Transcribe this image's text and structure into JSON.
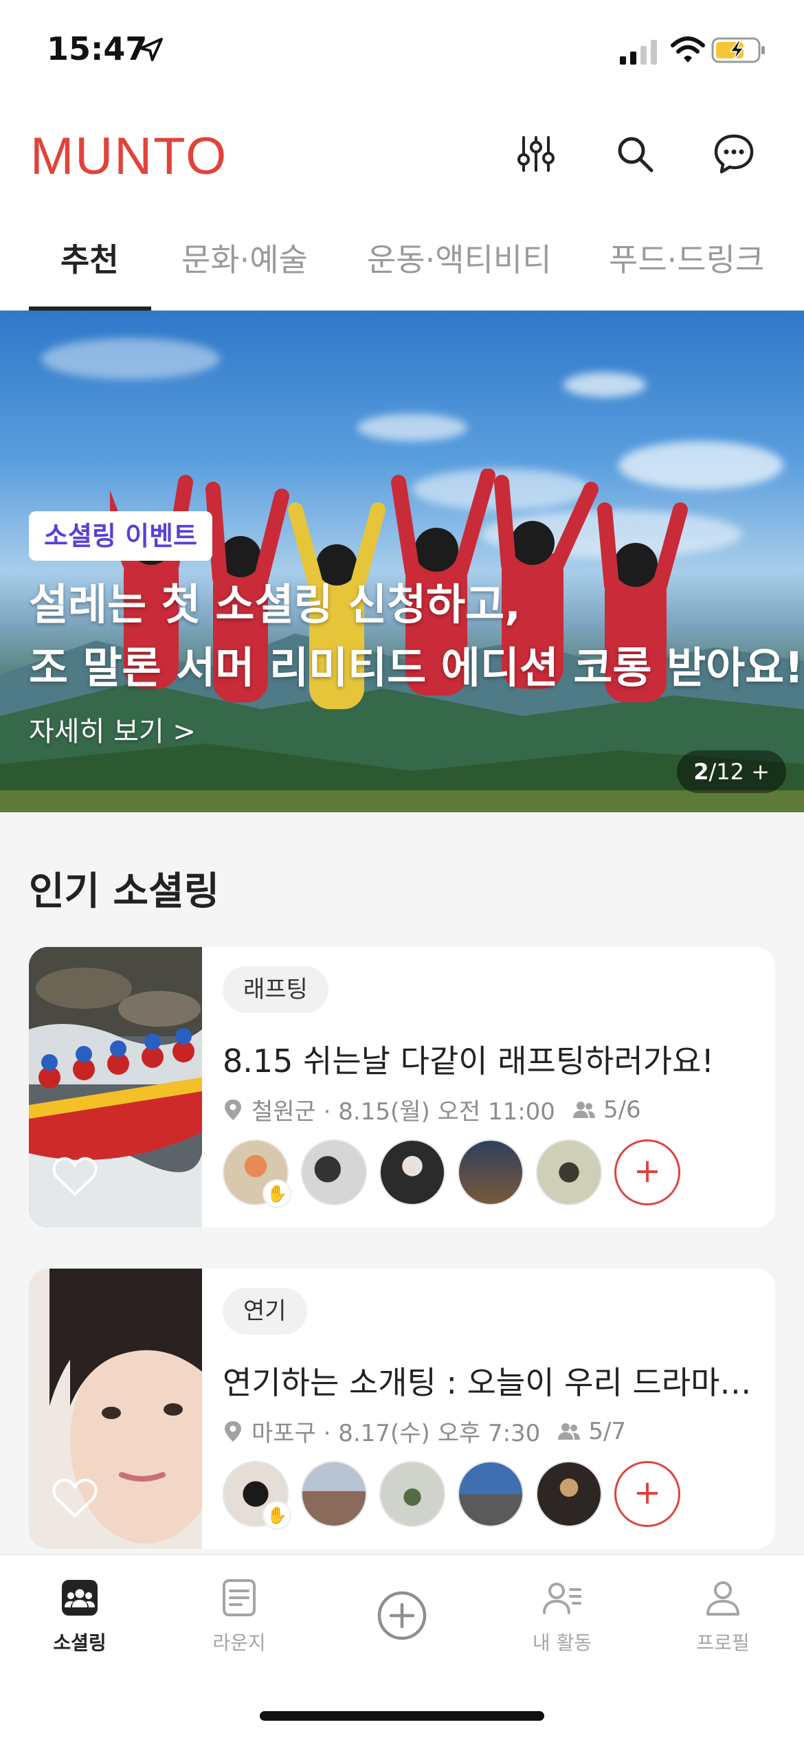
{
  "status_bar": {
    "time": "15:47"
  },
  "header": {
    "logo": "MUNTO",
    "icons": [
      "filter-icon",
      "search-icon",
      "chat-icon"
    ]
  },
  "tabs": [
    {
      "label": "추천",
      "active": true
    },
    {
      "label": "문화·예술",
      "active": false
    },
    {
      "label": "운동·액티비티",
      "active": false
    },
    {
      "label": "푸드·드링크",
      "active": false
    }
  ],
  "banner": {
    "badge": "소셜링 이벤트",
    "title_line1": "설레는 첫 소셜링 신청하고,",
    "title_line2": "조 말론 서머 리미티드 에디션 코롱 받아요!",
    "more": "자세히 보기 >",
    "counter_current": "2",
    "counter_total": "/12 +"
  },
  "popular": {
    "title": "인기 소셜링",
    "cards": [
      {
        "category": "래프팅",
        "title": "8.15 쉬는날 다같이 래프팅하러가요!",
        "location": "철원군 · 8.15(월) 오전 11:00",
        "members": "5/6",
        "liked": false
      },
      {
        "category": "연기",
        "title": "연기하는 소개팅 : 오늘이 우리 드라마의 ...",
        "location": "마포구 · 8.17(수) 오후 7:30",
        "members": "5/7",
        "liked": false
      }
    ]
  },
  "bottom_nav": [
    {
      "label": "소셜링",
      "icon": "group-icon",
      "active": true
    },
    {
      "label": "라운지",
      "icon": "document-icon",
      "active": false
    },
    {
      "label": "",
      "icon": "plus-circle-icon",
      "active": false
    },
    {
      "label": "내 활동",
      "icon": "my-activity-icon",
      "active": false
    },
    {
      "label": "프로필",
      "icon": "profile-icon",
      "active": false
    }
  ],
  "colors": {
    "brand": "#e0433a",
    "event_badge_text": "#5b3fd6"
  }
}
